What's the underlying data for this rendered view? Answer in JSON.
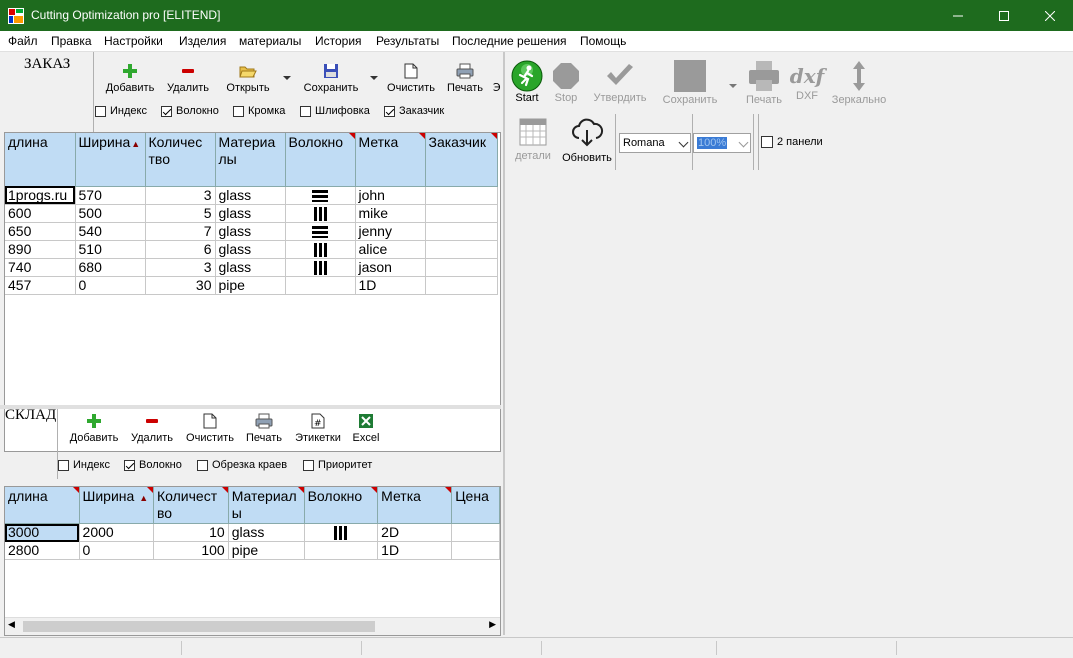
{
  "window": {
    "title": "Cutting Optimization pro [ELITEND]"
  },
  "menu": [
    "Файл",
    "Правка",
    "Настройки",
    "Изделия",
    "материалы",
    "История",
    "Результаты",
    "Последние решения",
    "Помощь"
  ],
  "order": {
    "label": "ЗАКАЗ",
    "toolbar": {
      "add": "Добавить",
      "delete": "Удалить",
      "open": "Открыть",
      "save": "Сохранить",
      "clear": "Очистить",
      "print": "Печать"
    },
    "checks": [
      {
        "label": "Индекс",
        "checked": false
      },
      {
        "label": "Волокно",
        "checked": true
      },
      {
        "label": "Кромка",
        "checked": false
      },
      {
        "label": "Шлифовка",
        "checked": false
      },
      {
        "label": "Заказчик",
        "checked": true
      }
    ],
    "columns": [
      "длина",
      "Ширина",
      "Количество",
      "Материалы",
      "Волокно",
      "Метка",
      "Заказчик"
    ],
    "columns_display": [
      "длина",
      "Ширина",
      "Количес тво",
      "Материа лы",
      "Волокно",
      "Метка",
      "Заказчик"
    ],
    "rows": [
      [
        "1progs.ru",
        "570",
        "3",
        "glass",
        "horizontal",
        "john",
        ""
      ],
      [
        "600",
        "500",
        "5",
        "glass",
        "vertical",
        "mike",
        ""
      ],
      [
        "650",
        "540",
        "7",
        "glass",
        "horizontal",
        "jenny",
        ""
      ],
      [
        "890",
        "510",
        "6",
        "glass",
        "vertical",
        "alice",
        ""
      ],
      [
        "740",
        "680",
        "3",
        "glass",
        "vertical",
        "jason",
        ""
      ],
      [
        "457",
        "0",
        "30",
        "pipe",
        "",
        "1D",
        ""
      ]
    ]
  },
  "stock": {
    "label": "СКЛАД",
    "toolbar": {
      "add": "Добавить",
      "delete": "Удалить",
      "clear": "Очистить",
      "print": "Печать",
      "labels": "Этикетки",
      "excel": "Excel"
    },
    "checks": [
      {
        "label": "Индекс",
        "checked": false
      },
      {
        "label": "Волокно",
        "checked": true
      },
      {
        "label": "Обрезка краев",
        "checked": false
      },
      {
        "label": "Приоритет",
        "checked": false
      }
    ],
    "columns": [
      "длина",
      "Ширина",
      "Количество",
      "Материалы",
      "Волокно",
      "Метка",
      "Цена"
    ],
    "columns_display": [
      "длина",
      "Ширина",
      "Количест во",
      "Материал ы",
      "Волокно",
      "Метка",
      "Цена"
    ],
    "rows": [
      [
        "3000",
        "2000",
        "10",
        "glass",
        "vertical",
        "2D",
        ""
      ],
      [
        "2800",
        "0",
        "100",
        "pipe",
        "",
        "1D",
        ""
      ]
    ]
  },
  "results_toolbar": {
    "start": "Start",
    "stop": "Stop",
    "confirm": "Утвердить",
    "save": "Сохранить",
    "print": "Печать",
    "dxf": "DXF",
    "dxf_logo": "dxf",
    "mirror": "Зеркально",
    "details": "детали",
    "refresh": "Обновить",
    "font_value": "Romana",
    "zoom_value": "100%",
    "two_panels": "2 панели"
  }
}
